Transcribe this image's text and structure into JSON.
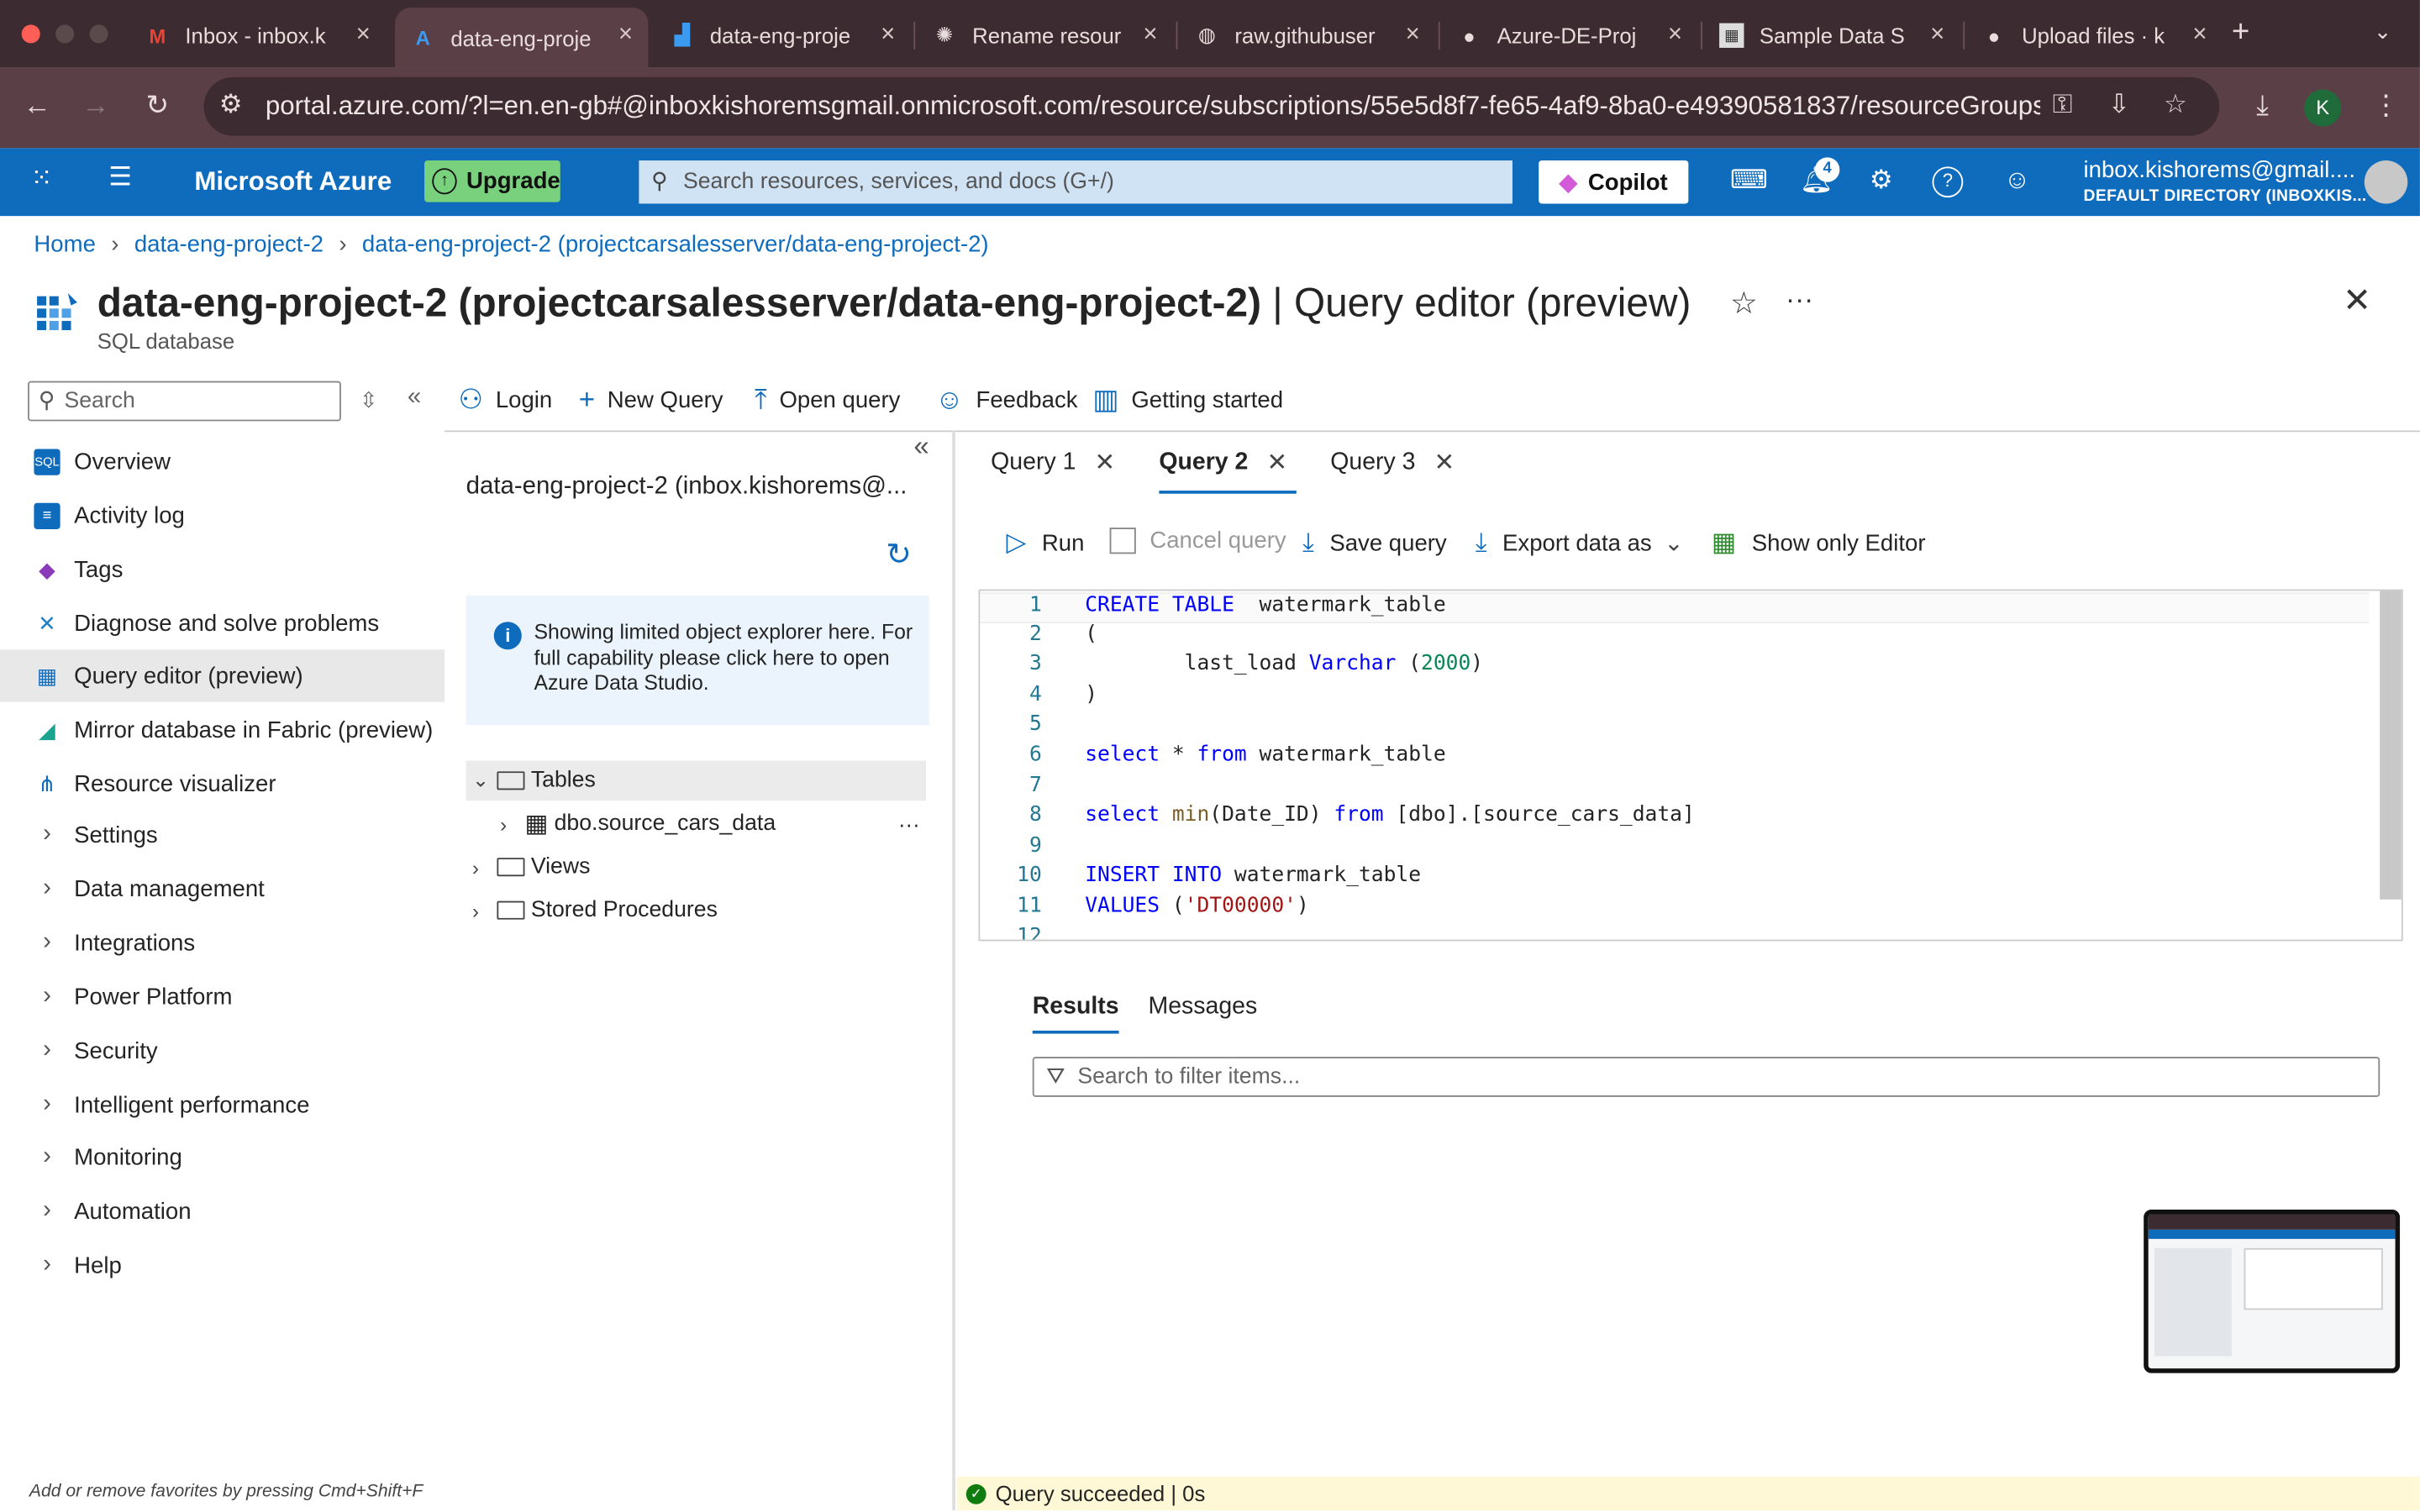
{
  "browser": {
    "tabs": [
      {
        "title": "Inbox - inbox.k",
        "icon": "gmail-icon"
      },
      {
        "title": "data-eng-proje",
        "icon": "azure-icon",
        "active": true
      },
      {
        "title": "data-eng-proje",
        "icon": "data-factory-icon"
      },
      {
        "title": "Rename resour",
        "icon": "chatgpt-icon"
      },
      {
        "title": "raw.githubuser",
        "icon": "globe-icon"
      },
      {
        "title": "Azure-DE-Proj",
        "icon": "github-icon"
      },
      {
        "title": "Sample Data S",
        "icon": "dataset-icon"
      },
      {
        "title": "Upload files · k",
        "icon": "github-icon"
      }
    ],
    "url": "portal.azure.com/?l=en.en-gb#@inboxkishoremsgmail.onmicrosoft.com/resource/subscriptions/55e5d8f7-fe65-4af9-8ba0-e49390581837/resourceGroups/d...",
    "profile_initial": "K"
  },
  "azure": {
    "brand": "Microsoft Azure",
    "upgrade_label": "Upgrade",
    "search_placeholder": "Search resources, services, and docs (G+/)",
    "copilot_label": "Copilot",
    "notification_count": "4",
    "user_name": "inbox.kishorems@gmail....",
    "user_directory": "DEFAULT DIRECTORY (INBOXKIS..."
  },
  "breadcrumbs": [
    "Home",
    "data-eng-project-2",
    "data-eng-project-2 (projectcarsalesserver/data-eng-project-2)"
  ],
  "page": {
    "title_bold": "data-eng-project-2 (projectcarsalesserver/data-eng-project-2)",
    "title_suffix": " | Query editor (preview)",
    "subtitle": "SQL database"
  },
  "leftnav": {
    "search_placeholder": "Search",
    "items": [
      {
        "label": "Overview",
        "icon": "sql-icon"
      },
      {
        "label": "Activity log",
        "icon": "activity-log-icon"
      },
      {
        "label": "Tags",
        "icon": "tag-icon"
      },
      {
        "label": "Diagnose and solve problems",
        "icon": "wrench-icon"
      },
      {
        "label": "Query editor (preview)",
        "icon": "query-editor-icon",
        "selected": true
      },
      {
        "label": "Mirror database in Fabric (preview)",
        "icon": "fabric-icon"
      },
      {
        "label": "Resource visualizer",
        "icon": "visualizer-icon"
      },
      {
        "label": "Settings",
        "group": true
      },
      {
        "label": "Data management",
        "group": true
      },
      {
        "label": "Integrations",
        "group": true
      },
      {
        "label": "Power Platform",
        "group": true
      },
      {
        "label": "Security",
        "group": true
      },
      {
        "label": "Intelligent performance",
        "group": true
      },
      {
        "label": "Monitoring",
        "group": true
      },
      {
        "label": "Automation",
        "group": true
      },
      {
        "label": "Help",
        "group": true
      }
    ],
    "favorites_tip": "Add or remove favorites by pressing Cmd+Shift+F"
  },
  "commandbar": [
    "Login",
    "New Query",
    "Open query",
    "Feedback",
    "Getting started"
  ],
  "explorer": {
    "title": "data-eng-project-2 (inbox.kishorems@...",
    "info_text": "Showing limited object explorer here. For full capability please click here to open Azure Data Studio.",
    "tables_label": "Tables",
    "table_item": "dbo.source_cars_data",
    "views_label": "Views",
    "procs_label": "Stored Procedures"
  },
  "query_tabs": [
    "Query 1",
    "Query 2",
    "Query 3"
  ],
  "query_toolbar": [
    "Run",
    "Cancel query",
    "Save query",
    "Export data as",
    "Show only Editor"
  ],
  "editor": {
    "line_numbers": [
      "1",
      "2",
      "3",
      "4",
      "5",
      "6",
      "7",
      "8",
      "9",
      "10",
      "11",
      "12"
    ],
    "l1_kw": "CREATE TABLE",
    "l1_rest": "  watermark_table",
    "l2": "(",
    "l3_a": "        last_load ",
    "l3_kw": "Varchar",
    "l3_b": " (",
    "l3_num": "2000",
    "l3_c": ")",
    "l4": ")",
    "l6_kw1": "select",
    "l6_a": " * ",
    "l6_kw2": "from",
    "l6_b": " watermark_table",
    "l8_kw1": "select",
    "l8_fn": " min",
    "l8_a": "(Date_ID) ",
    "l8_kw2": "from",
    "l8_b": " [dbo].[source_cars_data]",
    "l10_kw": "INSERT INTO",
    "l10_rest": " watermark_table",
    "l11_kw": "VALUES",
    "l11_a": " (",
    "l11_str": "'DT00000'",
    "l11_b": ")"
  },
  "results": {
    "tabs": [
      "Results",
      "Messages"
    ],
    "filter_placeholder": "Search to filter items..."
  },
  "status_text": "Query succeeded | 0s"
}
